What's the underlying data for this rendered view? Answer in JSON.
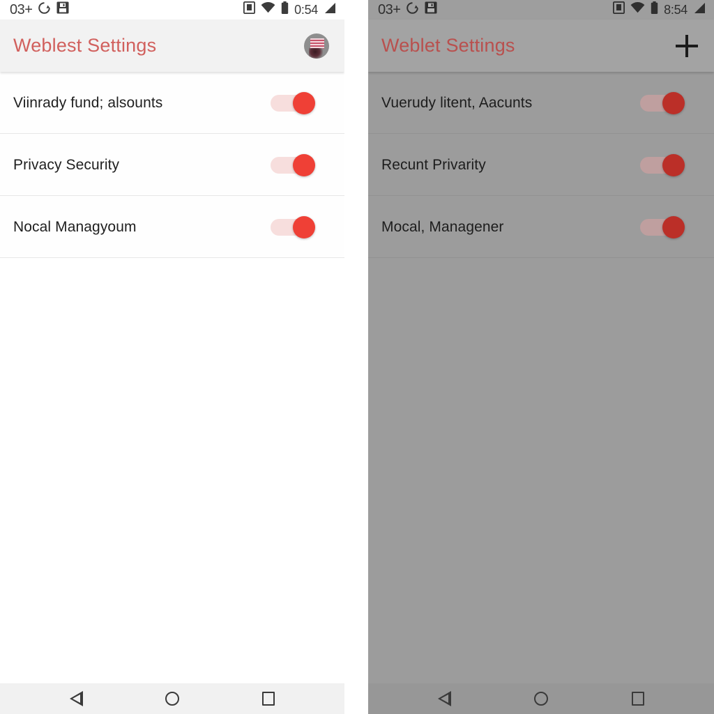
{
  "left_phone": {
    "status_bar": {
      "notification_count": "03+",
      "icons_left": [
        "sync-icon",
        "save-icon"
      ],
      "icons_right": [
        "sd-card-icon",
        "wifi-icon",
        "battery-icon",
        "signal-icon"
      ],
      "time": "0:54"
    },
    "app_bar": {
      "title": "Weblest Settings",
      "action_icon": "avatar"
    },
    "settings_rows": [
      {
        "label": "Viinrady fund; alsounts",
        "toggle_state": "on"
      },
      {
        "label": "Privacy Security",
        "toggle_state": "on"
      },
      {
        "label": "Nocal Managyoum",
        "toggle_state": "on"
      }
    ],
    "nav_bar": {
      "back": "back-triangle",
      "home": "home-circle",
      "recents": "recents-square"
    }
  },
  "right_phone": {
    "status_bar": {
      "notification_count": "03+",
      "icons_left": [
        "sync-icon",
        "save-icon"
      ],
      "icons_right": [
        "sd-card-icon",
        "wifi-icon",
        "battery-icon",
        "signal-icon"
      ],
      "time": "8:54"
    },
    "app_bar": {
      "title": "Weblet Settings",
      "action_icon": "plus"
    },
    "settings_rows": [
      {
        "label": "Vuerudy litent, Aacunts",
        "toggle_state": "on"
      },
      {
        "label": "Recunt Privarity",
        "toggle_state": "on"
      },
      {
        "label": "Mocal, Managener",
        "toggle_state": "on"
      }
    ],
    "nav_bar": {
      "back": "back-triangle",
      "home": "home-circle",
      "recents": "recents-square"
    }
  },
  "colors": {
    "accent_red": "#d1605d",
    "toggle_thumb": "#ef4036",
    "toggle_track": "#f7dedd",
    "left_bg": "#ffffff",
    "right_bg": "#9c9c9c",
    "appbar_left_bg": "#f2f2f2",
    "appbar_right_bg": "#a3a3a3"
  }
}
